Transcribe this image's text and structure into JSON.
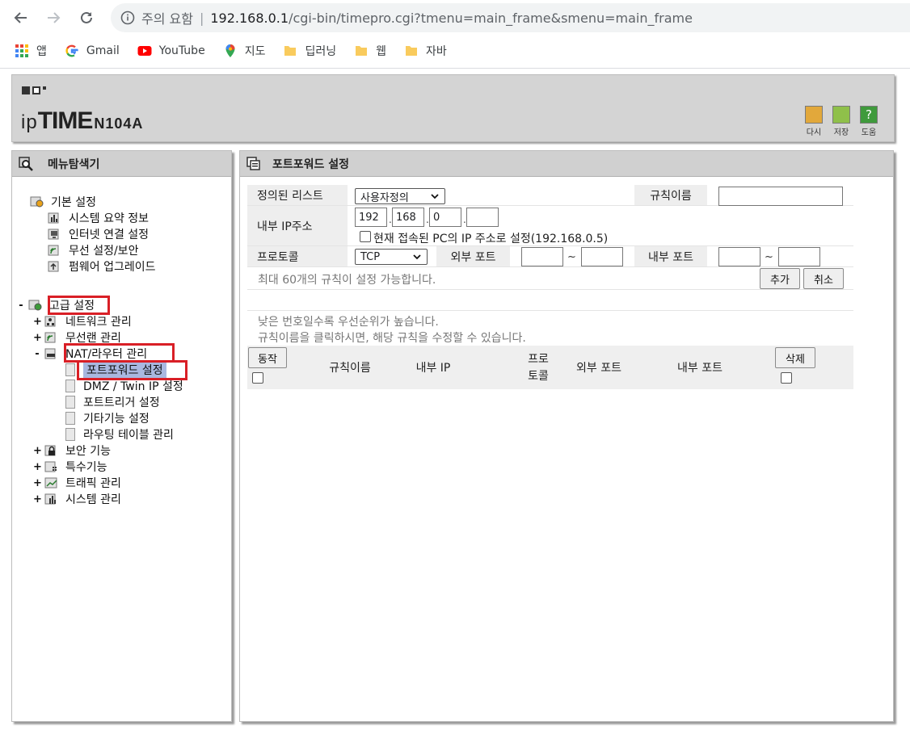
{
  "browser": {
    "security_label": "주의 요함",
    "url_host": "192.168.0.1",
    "url_path": "/cgi-bin/timepro.cgi?tmenu=main_frame&smenu=main_frame",
    "bookmarks": [
      "앱",
      "Gmail",
      "YouTube",
      "지도",
      "딥러닝",
      "웹",
      "자바"
    ]
  },
  "header": {
    "brand_ip": "ip",
    "brand_time": "TIME",
    "model": "N104A",
    "buttons": [
      "다시",
      "저장",
      "도움"
    ]
  },
  "left_panel": {
    "title": "메뉴탐색기",
    "basic_setup": "기본 설정",
    "basic_items": [
      "시스템 요약 정보",
      "인터넷 연결 설정",
      "무선 설정/보안",
      "펌웨어 업그레이드"
    ],
    "advanced_setup": "고급 설정",
    "advanced_items": [
      "네트워크 관리",
      "무선랜 관리",
      "NAT/라우터 관리"
    ],
    "nat_items": [
      "포트포워드 설정",
      "DMZ / Twin IP 설정",
      "포트트리거 설정",
      "기타기능 설정",
      "라우팅 테이블 관리"
    ],
    "other_items": [
      "보안 기능",
      "특수기능",
      "트래픽 관리",
      "시스템 관리"
    ],
    "toggle_minus": "-",
    "toggle_plus": "+"
  },
  "right_panel": {
    "title": "포트포워드 설정",
    "form": {
      "preset_label": "정의된 리스트",
      "preset_value": "사용자정의",
      "rule_name_label": "규칙이름",
      "rule_name_value": "",
      "internal_ip_label": "내부 IP주소",
      "ip_octets": [
        "192",
        "168",
        "0",
        ""
      ],
      "ip_dot": ".",
      "use_current_pc_label": "현재 접속된 PC의 IP 주소로 설정(192.168.0.5)",
      "protocol_label": "프로토콜",
      "protocol_value": "TCP",
      "external_port_label": "외부 포트",
      "internal_port_label": "내부 포트",
      "tilde": "~",
      "max_rules_note": "최대 60개의 규칙이 설정 가능합니다.",
      "add_button": "추가",
      "cancel_button": "취소"
    },
    "notes": [
      "낮은 번호일수록 우선순위가 높습니다.",
      "규칙이름을 클릭하시면, 해당 규칙을 수정할 수 있습니다."
    ],
    "table": {
      "action_button": "동작",
      "delete_button": "삭제",
      "columns": [
        "규칙이름",
        "내부 IP",
        "프로",
        "토콜",
        "외부 포트",
        "내부 포트"
      ]
    }
  },
  "colors": {
    "highlight": "#d91f26",
    "selected_bg": "#a9b8e0",
    "panel_header": "#d0d0d0"
  }
}
